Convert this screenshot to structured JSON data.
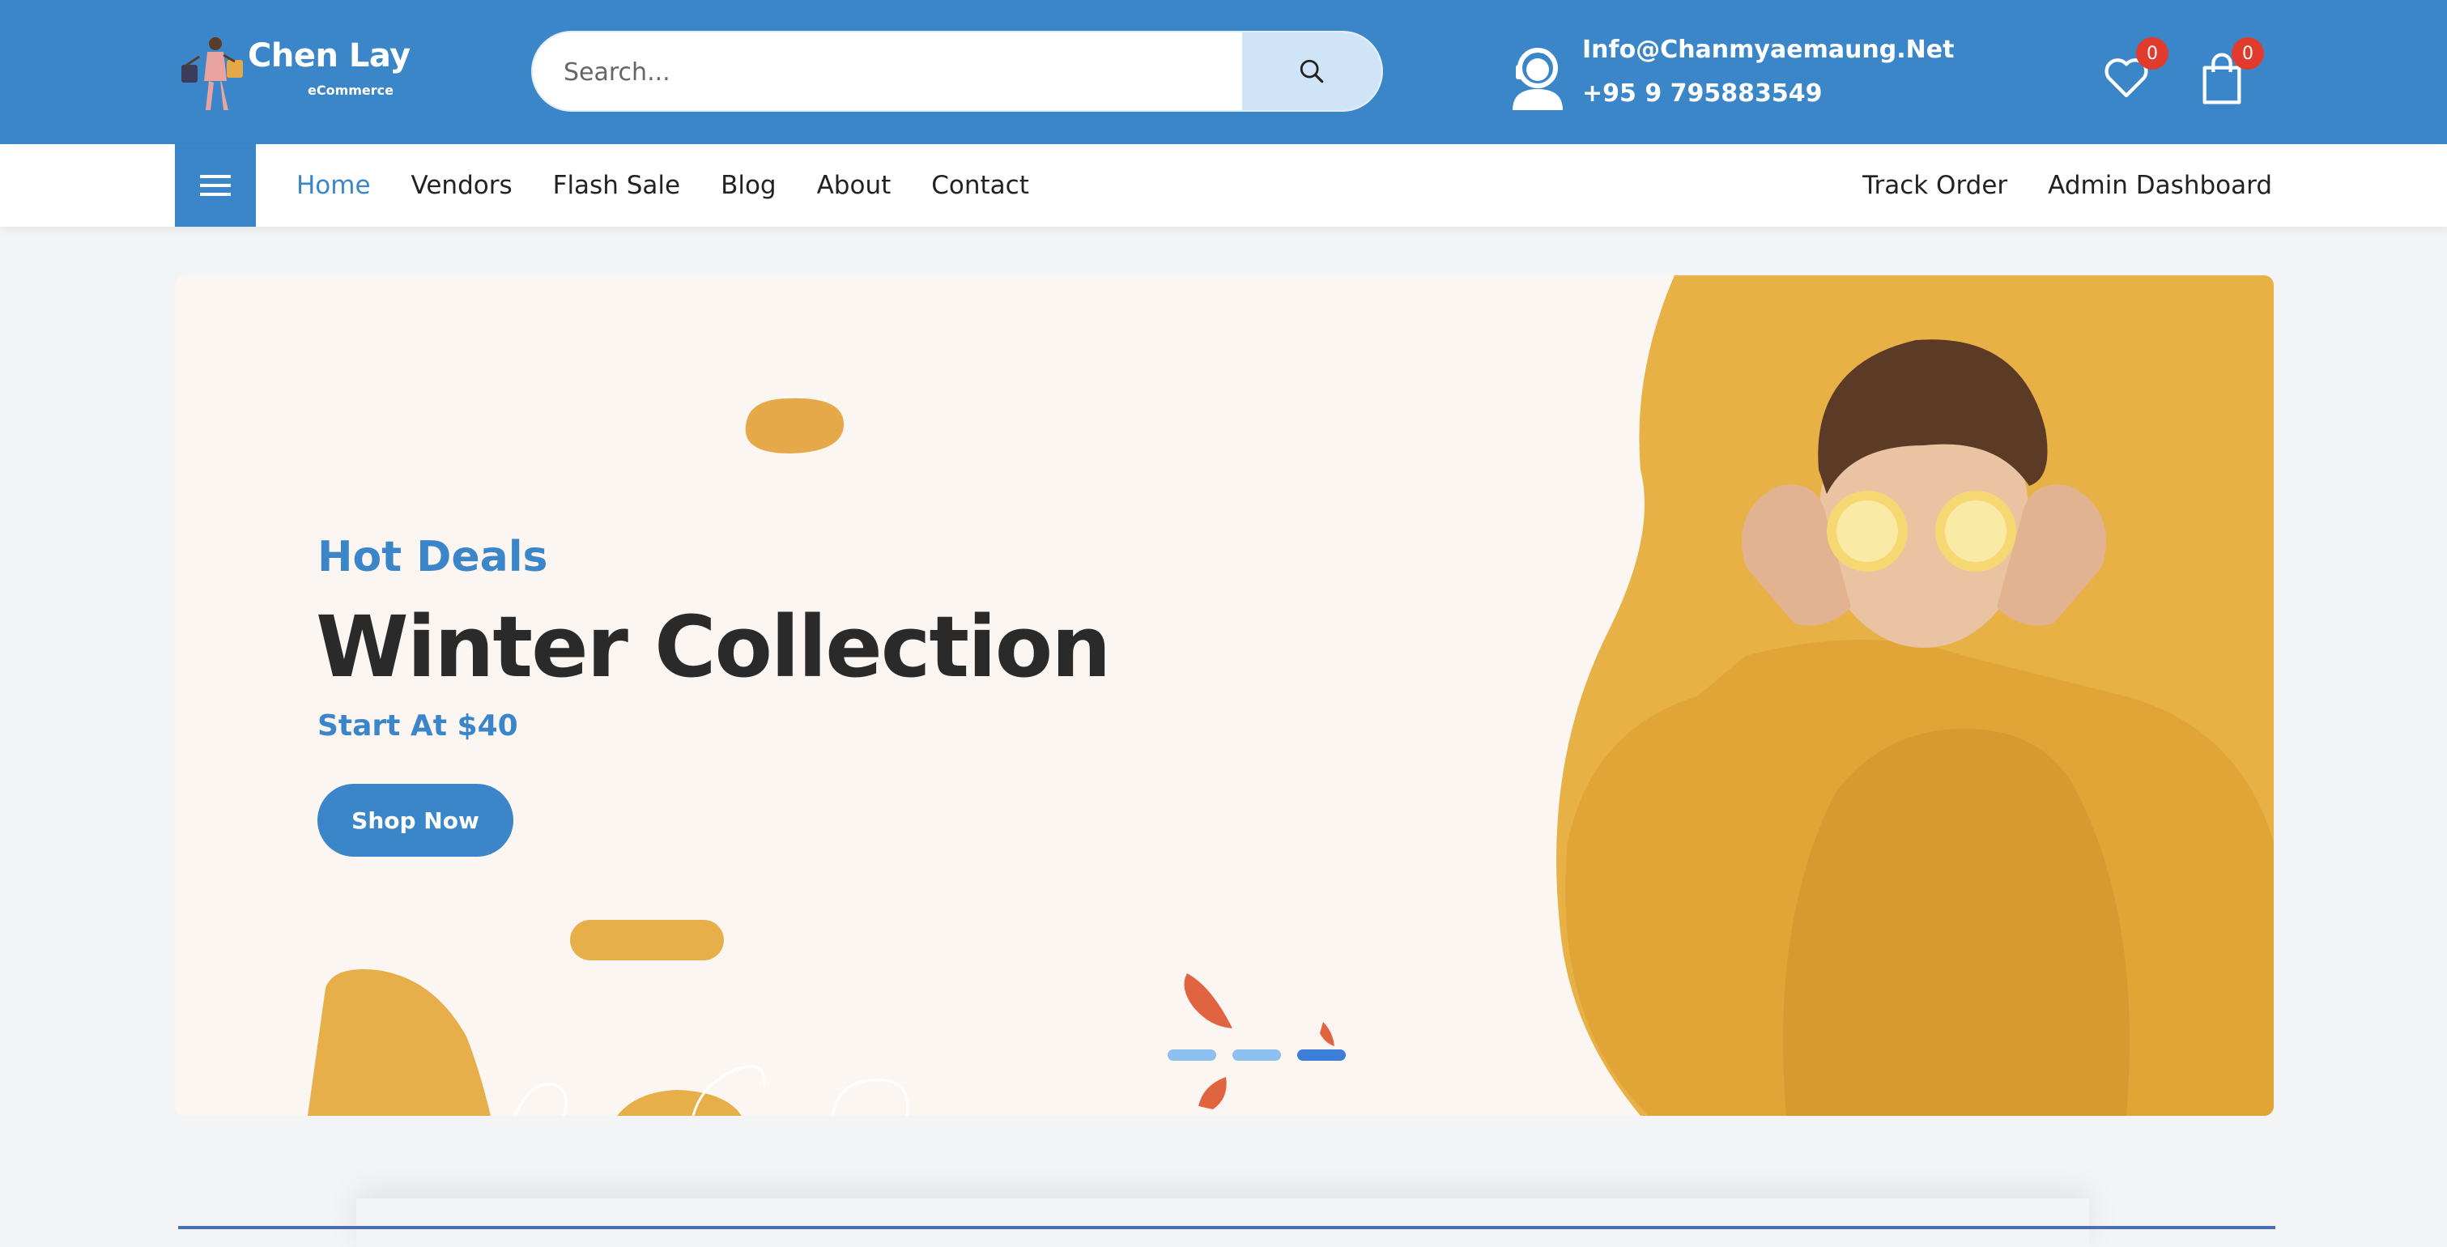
{
  "brand": {
    "name": "Chen Lay",
    "tagline": "eCommerce",
    "primary_color": "#3b86c8"
  },
  "search": {
    "placeholder": "Search...",
    "icon": "search-icon"
  },
  "contact": {
    "email": "Info@Chanmyaemaung.Net",
    "phone": "+95 9 795883549",
    "icon": "support-agent-icon"
  },
  "header_icons": {
    "wishlist_count": "0",
    "cart_count": "0"
  },
  "nav": {
    "menu_icon": "hamburger-icon",
    "links": [
      "Home",
      "Vendors",
      "Flash Sale",
      "Blog",
      "About",
      "Contact"
    ],
    "active": "Home",
    "right_links": [
      "Track Order",
      "Admin Dashboard"
    ]
  },
  "hero": {
    "eyebrow": "Hot Deals",
    "title": "Winter Collection",
    "price": "Start At $40",
    "button": "Shop Now",
    "slides_total": 3,
    "active_slide": 3
  }
}
